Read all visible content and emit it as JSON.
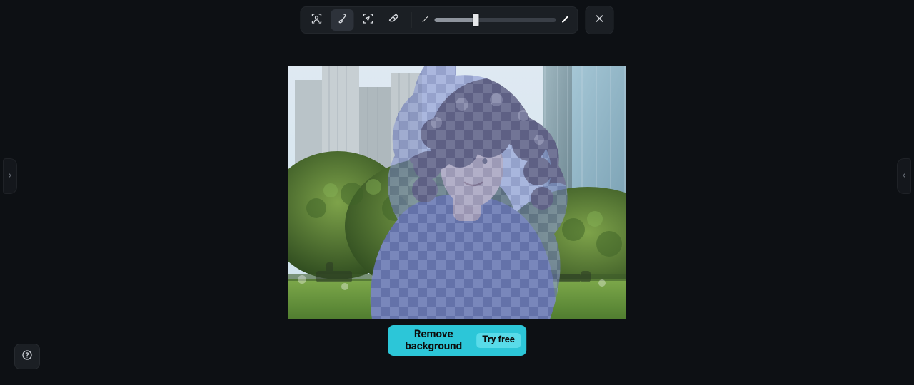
{
  "toolbar": {
    "tools": [
      {
        "name": "portrait-select-icon",
        "active": false
      },
      {
        "name": "brush-icon",
        "active": true
      },
      {
        "name": "lasso-select-icon",
        "active": false
      },
      {
        "name": "eraser-icon",
        "active": false
      }
    ],
    "brush_size": {
      "min_icon": "brush-small-icon",
      "max_icon": "brush-large-icon",
      "value_pct": 34
    }
  },
  "cta": {
    "label": "Remove background",
    "badge": "Try free"
  },
  "colors": {
    "accent": "#2cc6d8",
    "overlay": "#6f7ec1"
  }
}
